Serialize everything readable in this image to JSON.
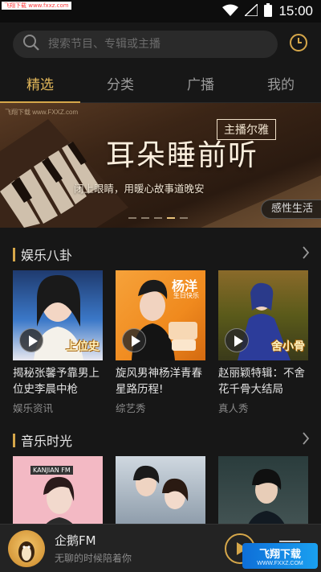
{
  "status_bar": {
    "watermark": "飞翔下载 www.fxxz.com",
    "time": "15:00",
    "icons": [
      "wifi-icon",
      "signal-icon",
      "battery-icon"
    ]
  },
  "search": {
    "placeholder": "搜索节目、专辑或主播",
    "icons": [
      "search-icon",
      "history-clock-icon"
    ]
  },
  "tabs": [
    {
      "label": "精选",
      "active": true
    },
    {
      "label": "分类",
      "active": false
    },
    {
      "label": "广播",
      "active": false
    },
    {
      "label": "我的",
      "active": false
    }
  ],
  "banner": {
    "watermark": "飞翔下载 www.FXXZ.com",
    "tag": "主播尔雅",
    "title": "耳朵睡前听",
    "subtitle": "闭上眼睛，用暖心故事道晚安",
    "label": "感性生活",
    "dots": 5,
    "active_dot": 4
  },
  "sections": [
    {
      "title": "娱乐八卦",
      "cards": [
        {
          "title": "揭秘张馨予靠男上位史李晨中枪",
          "subtitle": "娱乐资讯",
          "caption": "上位史"
        },
        {
          "title": "旋风男神杨洋青春星路历程!",
          "subtitle": "综艺秀",
          "caption": "杨洋",
          "caption2": "生日快乐"
        },
        {
          "title": "赵丽颖特辑：不舍花千骨大结局",
          "subtitle": "真人秀",
          "caption": "舍小骨"
        }
      ]
    },
    {
      "title": "音乐时光",
      "cards": [
        {
          "caption": "KANJIAN FM"
        },
        {},
        {}
      ]
    }
  ],
  "player": {
    "name": "企鹅FM",
    "desc": "无聊的时候陪着你",
    "icons": [
      "penguin-avatar-icon",
      "play-icon",
      "menu-icon"
    ]
  },
  "bottom_watermark": {
    "line1": "飞翔下载",
    "line2": "WWW.FXXZ.COM"
  },
  "colors": {
    "accent": "#d6a74a",
    "background": "#171717"
  }
}
